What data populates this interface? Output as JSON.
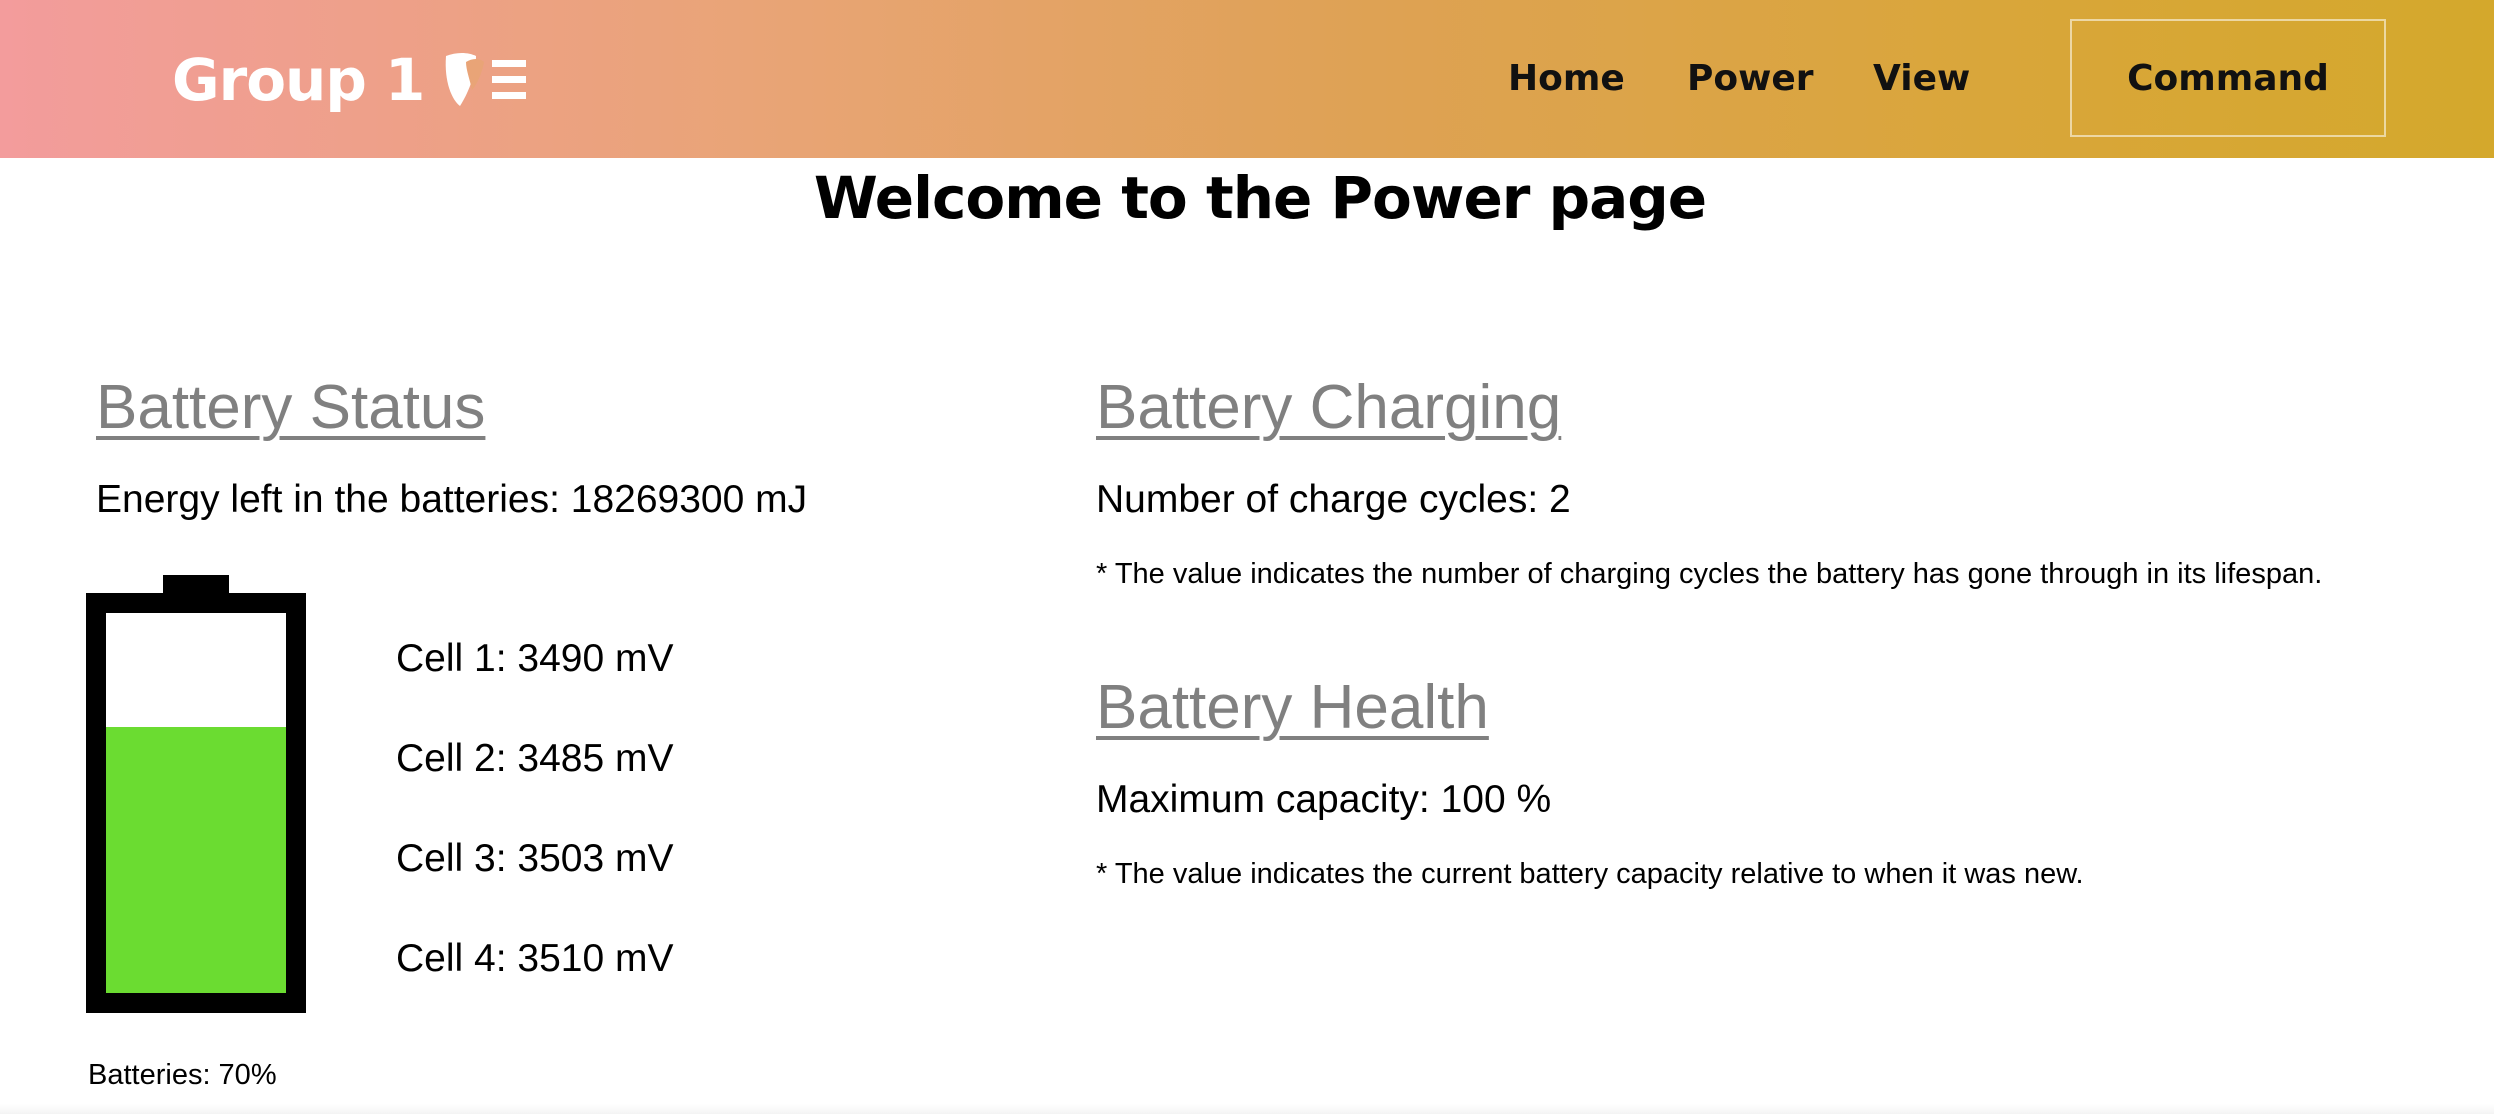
{
  "navbar": {
    "brand_label": "Group 1",
    "brand_icon": "typo3-logo-icon",
    "links": [
      {
        "label": "Home"
      },
      {
        "label": "Power"
      },
      {
        "label": "View"
      }
    ],
    "command_label": "Command",
    "colors": {
      "gradient_start": "#f39c9c",
      "gradient_end": "#d4a82c"
    }
  },
  "page": {
    "title": "Welcome to the Power page"
  },
  "battery_status": {
    "heading": "Battery Status",
    "energy_text": "Energy left in the batteries: 18269300 mJ",
    "cells": [
      {
        "text": "Cell 1: 3490 mV"
      },
      {
        "text": "Cell 2: 3485 mV"
      },
      {
        "text": "Cell 3: 3503 mV"
      },
      {
        "text": "Cell 4: 3510 mV"
      }
    ],
    "charge_percent": 70,
    "charge_label": "Batteries: 70%",
    "fill_color": "#6bdc31"
  },
  "battery_charging": {
    "heading": "Battery Charging",
    "cycles_text": "Number of charge cycles: 2",
    "note": "* The value indicates the number of charging cycles the battery has gone through in its lifespan."
  },
  "battery_health": {
    "heading": "Battery Health",
    "capacity_text": "Maximum capacity: 100 %",
    "note": "* The value indicates the current battery capacity relative to when it was new."
  }
}
